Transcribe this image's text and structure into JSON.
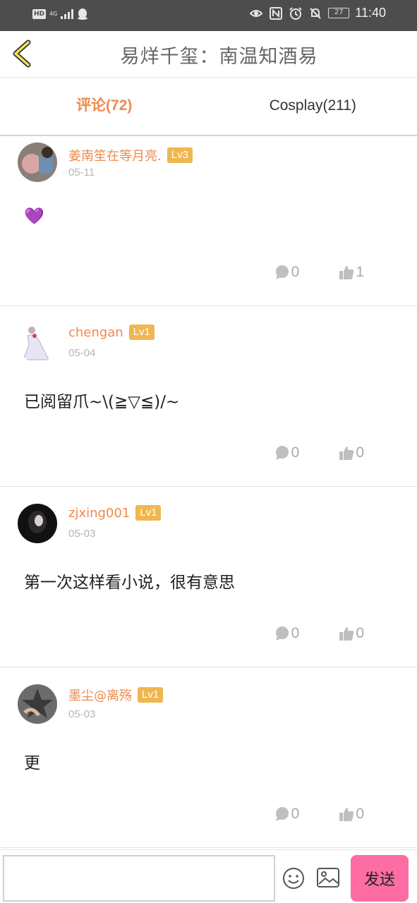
{
  "status_bar": {
    "network_left": "HD",
    "network_type": "4G",
    "battery": "27",
    "time": "11:40"
  },
  "header": {
    "title": "易烊千玺：南温知酒易"
  },
  "tabs": [
    {
      "label": "评论(72)",
      "active": true
    },
    {
      "label": "Cosplay(211)",
      "active": false
    }
  ],
  "comments": [
    {
      "username": "姜南笙在等月亮.",
      "level": "Lv3",
      "date": "05-11",
      "content": "💜",
      "reply_count": "0",
      "like_count": "1"
    },
    {
      "username": "chengan",
      "level": "Lv1",
      "date": "05-04",
      "content": "已阅留爪~\\(≧▽≦)/~",
      "reply_count": "0",
      "like_count": "0"
    },
    {
      "username": "zjxing001",
      "level": "Lv1",
      "date": "05-03",
      "content": "第一次这样看小说，很有意思",
      "reply_count": "0",
      "like_count": "0"
    },
    {
      "username": "墨尘@离殇",
      "level": "Lv1",
      "date": "05-03",
      "content": "更",
      "reply_count": "0",
      "like_count": "0"
    }
  ],
  "composer": {
    "input_value": "",
    "send_label": "发送"
  },
  "colors": {
    "accent": "#ee8a4d",
    "level_badge": "#f0b64f",
    "send_button": "#fd6ca3",
    "status_bar": "#4d4d4d"
  }
}
